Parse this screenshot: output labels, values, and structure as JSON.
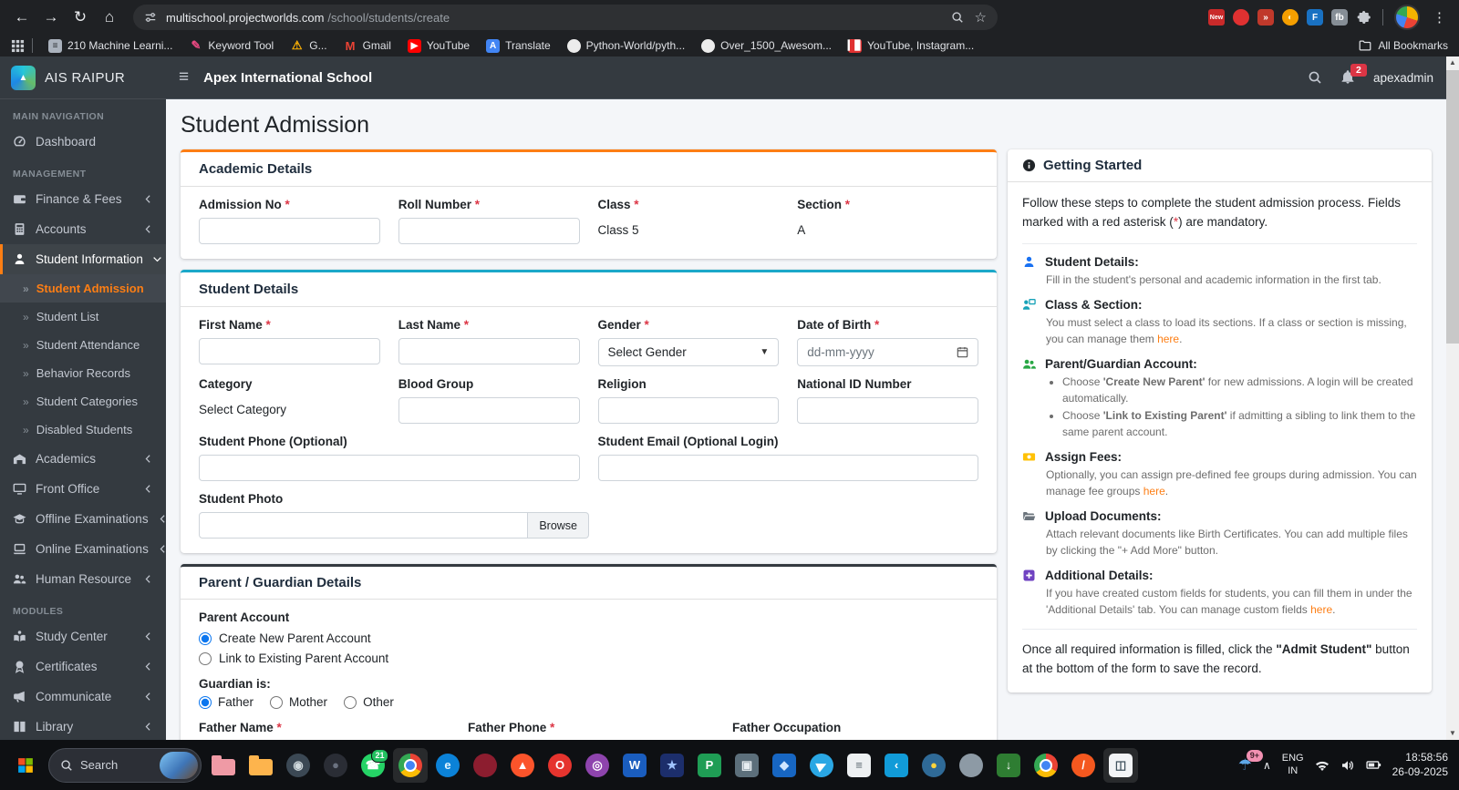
{
  "ui": {
    "required_mark": "*",
    "submenu_bullet": "»"
  },
  "browser": {
    "url": {
      "host": "multischool.projectworlds.com",
      "path": "/school/students/create"
    },
    "all_bookmarks": "All Bookmarks",
    "bookmarks": [
      {
        "label": "210 Machine Learni...",
        "icon": "document-icon",
        "kind": "square",
        "color": "#aab2bd",
        "glyph": "≡",
        "fg": "#2b2f33"
      },
      {
        "label": "Keyword Tool",
        "icon": "pencil-icon",
        "kind": "plain",
        "color": "",
        "glyph": "✎",
        "fg": "#e64980"
      },
      {
        "label": "G...",
        "icon": "warning-icon",
        "kind": "plain",
        "color": "",
        "glyph": "⚠",
        "fg": "#fab005"
      },
      {
        "label": "Gmail",
        "icon": "gmail-icon",
        "kind": "plain",
        "color": "",
        "glyph": "M",
        "fg": "#ea4335"
      },
      {
        "label": "YouTube",
        "icon": "youtube-icon",
        "kind": "square",
        "color": "#ff0000",
        "glyph": "▶",
        "fg": "#ffffff"
      },
      {
        "label": "Translate",
        "icon": "translate-icon",
        "kind": "square",
        "color": "#4285f4",
        "glyph": "A",
        "fg": "#ffffff"
      },
      {
        "label": "Python-World/pyth...",
        "icon": "github-icon",
        "kind": "circle",
        "color": "#ececec",
        "glyph": "",
        "fg": "#202124"
      },
      {
        "label": "Over_1500_Awesom...",
        "icon": "github-icon",
        "kind": "circle",
        "color": "#ececec",
        "glyph": "",
        "fg": "#202124"
      },
      {
        "label": "YouTube, Instagram...",
        "icon": "chart-icon",
        "kind": "square",
        "color": "#e03131",
        "glyph": "▎▊",
        "fg": "#ffffff"
      }
    ],
    "extensions": [
      {
        "name": "extension-new-icon",
        "kind": "badge",
        "color": "#c92a2a",
        "glyph": "New",
        "fg": "#ffffff"
      },
      {
        "name": "extension-red-dot-icon",
        "kind": "circle",
        "color": "#e03131",
        "glyph": "",
        "fg": "#ffffff"
      },
      {
        "name": "extension-red-square-icon",
        "kind": "square",
        "color": "#c0392b",
        "glyph": "»",
        "fg": "#ffffff"
      },
      {
        "name": "extension-orange-swirl-icon",
        "kind": "circle",
        "color": "#f59f00",
        "glyph": "◐",
        "fg": "#fff3bf"
      },
      {
        "name": "extension-blue-icon",
        "kind": "square",
        "color": "#1971c2",
        "glyph": "F",
        "fg": "#ffffff"
      },
      {
        "name": "extension-gray-icon",
        "kind": "square",
        "color": "#868e96",
        "glyph": "fb",
        "fg": "#ffffff"
      }
    ]
  },
  "navbar": {
    "school_name": "Apex International School",
    "notification_count": "2",
    "username": "apexadmin"
  },
  "sidebar": {
    "brand": "AIS RAIPUR",
    "items": [
      {
        "type": "header",
        "label": "MAIN NAVIGATION"
      },
      {
        "type": "item",
        "label": "Dashboard",
        "icon": "dashboard-icon"
      },
      {
        "type": "header",
        "label": "MANAGEMENT"
      },
      {
        "type": "item",
        "label": "Finance & Fees",
        "icon": "wallet-icon",
        "chevron": true
      },
      {
        "type": "item",
        "label": "Accounts",
        "icon": "calculator-icon",
        "chevron": true
      },
      {
        "type": "item",
        "label": "Student Information",
        "icon": "person-icon",
        "expanded": true,
        "active": true
      },
      {
        "type": "subitem",
        "label": "Student Admission",
        "active": true
      },
      {
        "type": "subitem",
        "label": "Student List"
      },
      {
        "type": "subitem",
        "label": "Student Attendance"
      },
      {
        "type": "subitem",
        "label": "Behavior Records"
      },
      {
        "type": "subitem",
        "label": "Student Categories"
      },
      {
        "type": "subitem",
        "label": "Disabled Students"
      },
      {
        "type": "item",
        "label": "Academics",
        "icon": "school-icon",
        "chevron": true
      },
      {
        "type": "item",
        "label": "Front Office",
        "icon": "monitor-icon",
        "chevron": true
      },
      {
        "type": "item",
        "label": "Offline Examinations",
        "icon": "gradcap-icon",
        "chevron": true
      },
      {
        "type": "item",
        "label": "Online Examinations",
        "icon": "laptop-icon",
        "chevron": true
      },
      {
        "type": "item",
        "label": "Human Resource",
        "icon": "usersgear-icon",
        "chevron": true
      },
      {
        "type": "header",
        "label": "MODULES"
      },
      {
        "type": "item",
        "label": "Study Center",
        "icon": "bookreader-icon",
        "chevron": true
      },
      {
        "type": "item",
        "label": "Certificates",
        "icon": "certificate-icon",
        "chevron": true
      },
      {
        "type": "item",
        "label": "Communicate",
        "icon": "megaphone-icon",
        "chevron": true
      },
      {
        "type": "item",
        "label": "Library",
        "icon": "book-icon",
        "chevron": true
      }
    ]
  },
  "page": {
    "title": "Student Admission"
  },
  "academic_card": {
    "title": "Academic Details",
    "fields": {
      "admission_no": {
        "label": "Admission No"
      },
      "roll_number": {
        "label": "Roll Number"
      },
      "class": {
        "label": "Class",
        "value": "Class 5"
      },
      "section": {
        "label": "Section",
        "value": "A"
      }
    }
  },
  "student_card": {
    "title": "Student Details",
    "first_name": {
      "label": "First Name"
    },
    "last_name": {
      "label": "Last Name"
    },
    "gender": {
      "label": "Gender",
      "value": "Select Gender"
    },
    "dob": {
      "label": "Date of Birth",
      "placeholder": "dd-mm-yyyy"
    },
    "category": {
      "label": "Category",
      "value": "Select Category"
    },
    "blood_group": {
      "label": "Blood Group"
    },
    "religion": {
      "label": "Religion"
    },
    "national_id": {
      "label": "National ID Number"
    },
    "phone": {
      "label": "Student Phone (Optional)"
    },
    "email": {
      "label": "Student Email (Optional Login)"
    },
    "photo": {
      "label": "Student Photo",
      "browse": "Browse"
    }
  },
  "parent_card": {
    "title": "Parent / Guardian Details",
    "account_label": "Parent Account",
    "account_options": [
      {
        "label": "Create New Parent Account",
        "checked": true
      },
      {
        "label": "Link to Existing Parent Account",
        "checked": false
      }
    ],
    "guardian_label": "Guardian is:",
    "guardian_options": [
      {
        "label": "Father",
        "checked": true
      },
      {
        "label": "Mother",
        "checked": false
      },
      {
        "label": "Other",
        "checked": false
      }
    ],
    "bottom_fields": [
      {
        "label": "Father Name",
        "required": true
      },
      {
        "label": "Father Phone",
        "required": true
      },
      {
        "label": "Father Occupation",
        "required": false
      }
    ]
  },
  "getting_started": {
    "title": "Getting Started",
    "intro": [
      {
        "t": "Follow these steps to complete the student admission process. Fields marked with a red asterisk ("
      },
      {
        "t": "*",
        "red": true
      },
      {
        "t": ") are mandatory."
      }
    ],
    "steps": [
      {
        "icon": "student-details-icon",
        "color": "#1971f2",
        "title": "Student Details:",
        "desc": [
          {
            "t": "Fill in the student's personal and academic information in the first tab."
          }
        ]
      },
      {
        "icon": "class-section-icon",
        "color": "#17a2b8",
        "title": "Class & Section:",
        "desc": [
          {
            "t": "You must select a class to load its sections. If a class or section is missing, you can manage them "
          },
          {
            "t": "here",
            "link": true
          },
          {
            "t": "."
          }
        ]
      },
      {
        "icon": "parent-guardian-icon",
        "color": "#28a745",
        "title": "Parent/Guardian Account:",
        "bullets": [
          [
            {
              "t": "Choose "
            },
            {
              "t": "'Create New Parent'",
              "b": true
            },
            {
              "t": " for new admissions. A login will be created automatically."
            }
          ],
          [
            {
              "t": "Choose "
            },
            {
              "t": "'Link to Existing Parent'",
              "b": true
            },
            {
              "t": " if admitting a sibling to link them to the same parent account."
            }
          ]
        ]
      },
      {
        "icon": "assign-fees-icon",
        "color": "#ffc107",
        "title": "Assign Fees:",
        "desc": [
          {
            "t": "Optionally, you can assign pre-defined fee groups during admission. You can manage fee groups "
          },
          {
            "t": "here",
            "link": true
          },
          {
            "t": "."
          }
        ]
      },
      {
        "icon": "upload-documents-icon",
        "color": "#6c757d",
        "title": "Upload Documents:",
        "desc": [
          {
            "t": "Attach relevant documents like Birth Certificates. You can add multiple files by clicking the \"+ Add More\" button."
          }
        ]
      },
      {
        "icon": "additional-details-icon",
        "color": "#6f42c1",
        "title": "Additional Details:",
        "desc": [
          {
            "t": "If you have created custom fields for students, you can fill them in under the 'Additional Details' tab. You can manage custom fields "
          },
          {
            "t": "here",
            "link": true
          },
          {
            "t": "."
          }
        ]
      }
    ],
    "footer": [
      {
        "t": "Once all required information is filled, click the "
      },
      {
        "t": "\"Admit Student\"",
        "b": true
      },
      {
        "t": " button at the bottom of the form to save the record."
      }
    ]
  },
  "taskbar": {
    "search_placeholder": "Search",
    "language_line1": "ENG",
    "language_line2": "IN",
    "time": "18:58:56",
    "date": "26-09-2025",
    "tray_badge": "9+",
    "icons": [
      {
        "name": "pink-folder-icon",
        "kind": "folder",
        "color": "#ef9aa5"
      },
      {
        "name": "yellow-folder-icon",
        "kind": "folder",
        "color": "#fdb44d"
      },
      {
        "name": "steam-icon",
        "kind": "circle",
        "color": "#3b4854",
        "glyph": "◉",
        "fg": "#cfd8dc"
      },
      {
        "name": "dark-app-icon",
        "kind": "circle",
        "color": "#2a2d35",
        "glyph": "●",
        "fg": "#6b7280"
      },
      {
        "name": "whatsapp-icon",
        "kind": "circle",
        "color": "#25d366",
        "glyph": "☎",
        "fg": "#ffffff",
        "badge": "21"
      },
      {
        "name": "chrome-icon",
        "kind": "chrome",
        "open": true
      },
      {
        "name": "edge-icon",
        "kind": "circle",
        "color": "#0b82d8",
        "glyph": "e",
        "fg": "#e3f6ff"
      },
      {
        "name": "maroon-app-icon",
        "kind": "circle",
        "color": "#8c1d2f",
        "glyph": "",
        "fg": ""
      },
      {
        "name": "brave-icon",
        "kind": "circle",
        "color": "#fb542b",
        "glyph": "▲",
        "fg": "#ffffff"
      },
      {
        "name": "opera-icon",
        "kind": "circle",
        "color": "#e5342e",
        "glyph": "O",
        "fg": "#ffffff"
      },
      {
        "name": "purple-app-icon",
        "kind": "circle",
        "color": "#8e44ad",
        "glyph": "◎",
        "fg": "#ffffff"
      },
      {
        "name": "word-icon",
        "kind": "square",
        "color": "#1a5dbe",
        "glyph": "W",
        "fg": "#ffffff"
      },
      {
        "name": "photos-app-icon",
        "kind": "square",
        "color": "#1c2e6b",
        "glyph": "★",
        "fg": "#9fc3ff"
      },
      {
        "name": "green-app-icon",
        "kind": "square",
        "color": "#1f9d55",
        "glyph": "P",
        "fg": "#ffffff"
      },
      {
        "name": "monitor-app-icon",
        "kind": "square",
        "color": "#5c6f7b",
        "glyph": "▣",
        "fg": "#e7edf1"
      },
      {
        "name": "blue-cube-icon",
        "kind": "square",
        "color": "#1766c2",
        "glyph": "◆",
        "fg": "#cfe5ff"
      },
      {
        "name": "telegram-icon",
        "kind": "circle",
        "color": "#2aa7e4",
        "glyph": "▶",
        "fg": "#ffffff",
        "rot": -25
      },
      {
        "name": "notes-app-icon",
        "kind": "square",
        "color": "#edf0f2",
        "glyph": "≡",
        "fg": "#5b6770"
      },
      {
        "name": "vscode-icon",
        "kind": "square",
        "color": "#119bd8",
        "glyph": "‹",
        "fg": "#ffffff"
      },
      {
        "name": "python-icon",
        "kind": "circle",
        "color": "#2f6a97",
        "glyph": "●",
        "fg": "#ffd43b"
      },
      {
        "name": "gray-app-icon",
        "kind": "circle",
        "color": "#8d9aa5",
        "glyph": "",
        "fg": ""
      },
      {
        "name": "idm-icon",
        "kind": "square",
        "color": "#2e7d32",
        "glyph": "↓",
        "fg": "#ffffff"
      },
      {
        "name": "chrome-profile-icon",
        "kind": "chrome"
      },
      {
        "name": "orange-app-icon",
        "kind": "circle",
        "color": "#f4581f",
        "glyph": "/",
        "fg": "#ffffff"
      },
      {
        "name": "snipping-tool-icon",
        "kind": "square",
        "color": "#f2f4f6",
        "glyph": "◫",
        "fg": "#41525e",
        "open": true
      }
    ]
  }
}
